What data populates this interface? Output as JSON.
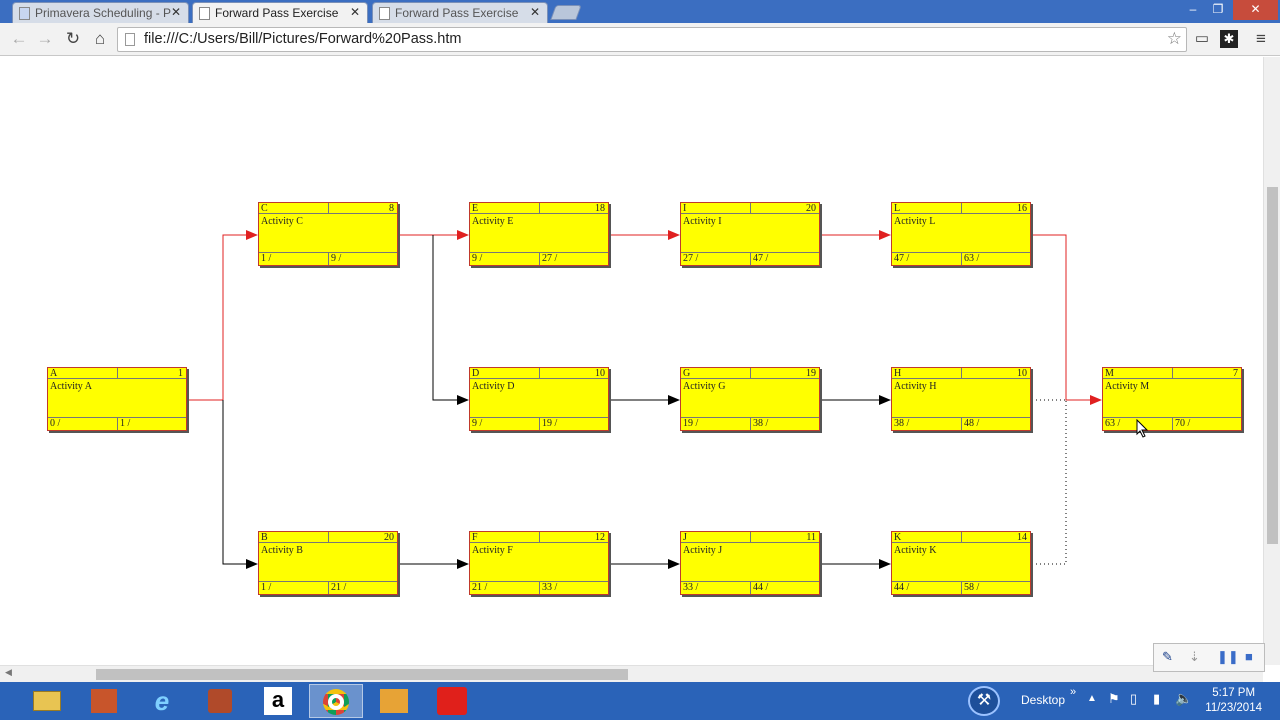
{
  "browser": {
    "tabs": [
      {
        "title": "Primavera Scheduling - P",
        "active": false
      },
      {
        "title": "Forward Pass Exercise",
        "active": true
      },
      {
        "title": "Forward Pass Exercise",
        "active": false
      }
    ],
    "url": "file:///C:/Users/Bill/Pictures/Forward%20Pass.htm"
  },
  "diagram": {
    "activities": [
      {
        "id": "A",
        "name": "Activity A",
        "duration": "1",
        "early_start": "0 /",
        "early_finish": "1 /"
      },
      {
        "id": "C",
        "name": "Activity C",
        "duration": "8",
        "early_start": "1 /",
        "early_finish": "9 /"
      },
      {
        "id": "E",
        "name": "Activity E",
        "duration": "18",
        "early_start": "9 /",
        "early_finish": "27 /"
      },
      {
        "id": "I",
        "name": "Activity I",
        "duration": "20",
        "early_start": "27 /",
        "early_finish": "47 /"
      },
      {
        "id": "L",
        "name": "Activity L",
        "duration": "16",
        "early_start": "47 /",
        "early_finish": "63 /"
      },
      {
        "id": "D",
        "name": "Activity D",
        "duration": "10",
        "early_start": "9 /",
        "early_finish": "19 /"
      },
      {
        "id": "G",
        "name": "Activity G",
        "duration": "19",
        "early_start": "19 /",
        "early_finish": "38 /"
      },
      {
        "id": "H",
        "name": "Activity H",
        "duration": "10",
        "early_start": "38 /",
        "early_finish": "48 /"
      },
      {
        "id": "M",
        "name": "Activity M",
        "duration": "7",
        "early_start": "63 /",
        "early_finish": "70 /"
      },
      {
        "id": "B",
        "name": "Activity B",
        "duration": "20",
        "early_start": "1 /",
        "early_finish": "21 /"
      },
      {
        "id": "F",
        "name": "Activity F",
        "duration": "12",
        "early_start": "21 /",
        "early_finish": "33 /"
      },
      {
        "id": "J",
        "name": "Activity J",
        "duration": "11",
        "early_start": "33 /",
        "early_finish": "44 /"
      },
      {
        "id": "K",
        "name": "Activity K",
        "duration": "14",
        "early_start": "44 /",
        "early_finish": "58 /"
      }
    ],
    "colors": {
      "box_fill": "#ffff00",
      "critical_link": "#e02020",
      "normal_link": "#000000"
    }
  },
  "taskbar": {
    "apps": [
      "file-explorer-icon",
      "powerpoint-icon",
      "internet-explorer-icon",
      "media-icon",
      "amazon-icon",
      "chrome-icon",
      "outlook-icon",
      "oracle-icon"
    ],
    "desktop_label": "Desktop",
    "time": "5:17 PM",
    "date": "11/23/2014"
  }
}
